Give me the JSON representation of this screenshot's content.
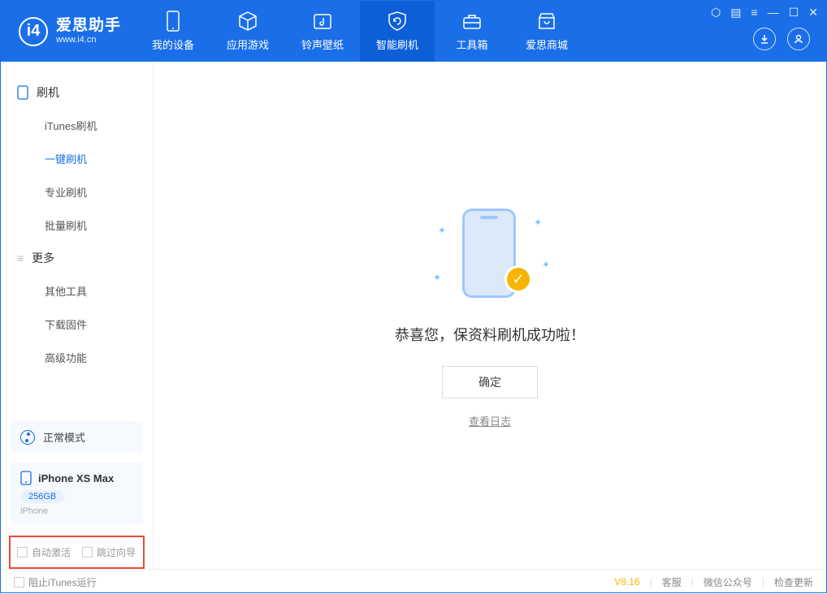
{
  "app": {
    "title": "爱思助手",
    "subtitle": "www.i4.cn"
  },
  "nav": {
    "items": [
      {
        "label": "我的设备"
      },
      {
        "label": "应用游戏"
      },
      {
        "label": "铃声壁纸"
      },
      {
        "label": "智能刷机"
      },
      {
        "label": "工具箱"
      },
      {
        "label": "爱思商城"
      }
    ]
  },
  "sidebar": {
    "group1": {
      "title": "刷机",
      "items": [
        "iTunes刷机",
        "一键刷机",
        "专业刷机",
        "批量刷机"
      ]
    },
    "group2": {
      "title": "更多",
      "items": [
        "其他工具",
        "下载固件",
        "高级功能"
      ]
    },
    "mode": {
      "label": "正常模式"
    },
    "device": {
      "name": "iPhone XS Max",
      "capacity": "256GB",
      "type": "iPhone"
    },
    "checks": {
      "auto_activate": "自动激活",
      "skip_guide": "跳过向导"
    }
  },
  "main": {
    "message": "恭喜您，保资料刷机成功啦！",
    "ok": "确定",
    "log_link": "查看日志"
  },
  "status": {
    "block_itunes": "阻止iTunes运行",
    "version": "V8.16",
    "support": "客服",
    "wechat": "微信公众号",
    "update": "检查更新"
  }
}
